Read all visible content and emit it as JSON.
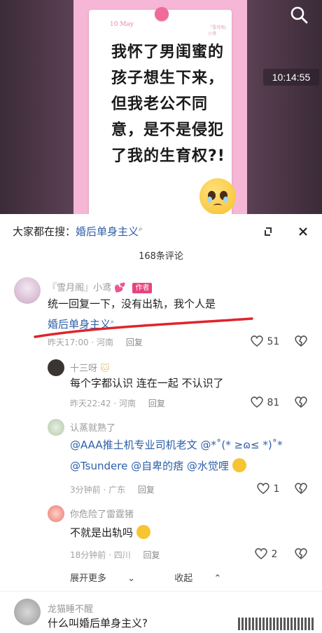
{
  "video": {
    "month_label": "10 May",
    "watermark_text": "「雪月阁」小鸢",
    "headline_lines": [
      "我怀了男闺蜜的",
      "孩子想生下来，",
      "但我老公不同",
      "意，是不是侵犯",
      "了我的生育权?!"
    ],
    "timestamp": "10:14:55",
    "search_icon": "search-icon"
  },
  "panel": {
    "search_prefix": "大家都在搜：",
    "search_keyword": "婚后单身主义",
    "comment_count": "168条评论",
    "expand_icon": "expand-icon",
    "close_icon": "close-icon"
  },
  "comments": [
    {
      "name": "『雪月阁』小鸢",
      "tag": "作者",
      "text_line1": "统一回复一下，没有出轨，我个人是",
      "text_link": "婚后单身主义",
      "time": "昨天17:00 · 河南",
      "reply": "回复",
      "likes": "51"
    },
    {
      "name": "十三呀",
      "text": "每个字都认识 连在一起 不认识了",
      "time": "昨天22:42 · 河南",
      "reply": "回复",
      "likes": "81"
    },
    {
      "name": "认蒸就熟了",
      "text_line1": "@AAA推土机专业司机老文 @*˚(* ≥ɷ≤ *)˚*",
      "text_line2": "@Tsundere @自卑的痞 @水觉哩",
      "time": "3分钟前 · 广东",
      "reply": "回复",
      "likes": "1"
    },
    {
      "name": "你危险了雷霆猪",
      "text": "不就是出轨吗",
      "time": "18分钟前 · 四川",
      "reply": "回复",
      "likes": "2"
    },
    {
      "name": "龙猫睡不醒",
      "text": "什么叫婚后单身主义?"
    }
  ],
  "more": {
    "expand": "展开更多",
    "collapse": "收起"
  },
  "colors": {
    "link": "#2e5fa8",
    "author_tag": "#e8437e",
    "poster_bg": "#f6b6d6"
  }
}
